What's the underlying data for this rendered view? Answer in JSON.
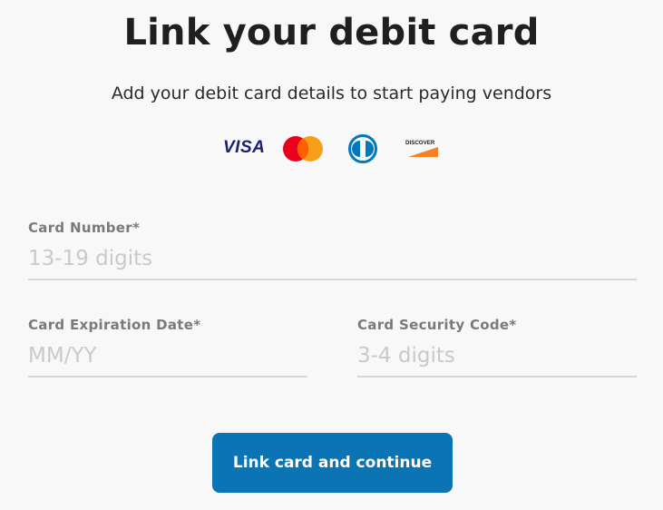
{
  "page": {
    "title": "Link your debit card",
    "subtitle": "Add your debit card details to start paying vendors"
  },
  "logos": {
    "visa": "VISA",
    "discover": "DISCOVER",
    "icons": [
      "visa-logo-icon",
      "mastercard-logo-icon",
      "diners-club-logo-icon",
      "discover-logo-icon"
    ]
  },
  "form": {
    "card_number": {
      "label": "Card Number*",
      "placeholder": "13-19 digits",
      "value": ""
    },
    "expiration": {
      "label": "Card Expiration Date*",
      "placeholder": "MM/YY",
      "value": ""
    },
    "security_code": {
      "label": "Card Security Code*",
      "placeholder": "3-4 digits",
      "value": ""
    }
  },
  "actions": {
    "submit_label": "Link card and continue"
  },
  "colors": {
    "primary": "#0a74b5",
    "visa": "#1a1f71",
    "mastercard_red": "#eb001b",
    "mastercard_orange": "#f79e1b",
    "diners": "#0079be",
    "discover_orange": "#f58220"
  }
}
